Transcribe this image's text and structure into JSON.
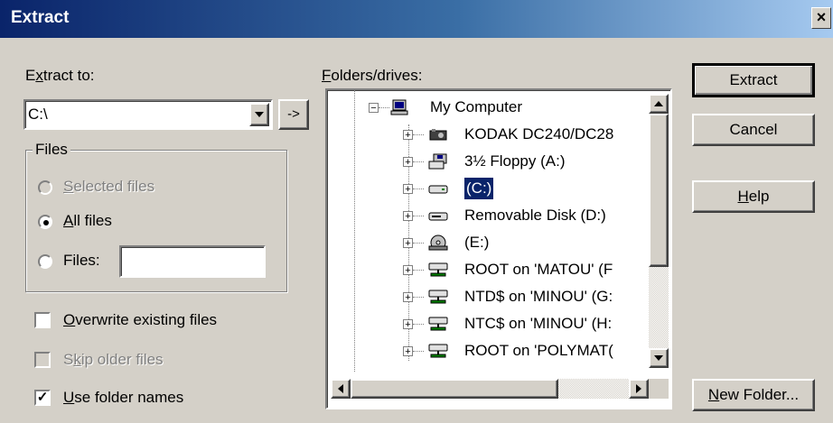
{
  "window": {
    "title": "Extract",
    "close_glyph": "×"
  },
  "extract_to": {
    "label_pre": "E",
    "label_ul": "x",
    "label_post": "tract to:",
    "value": "C:\\",
    "go_label": "->"
  },
  "files_group": {
    "legend": "Files",
    "selected": {
      "ul": "S",
      "rest": "elected files",
      "enabled": false
    },
    "all": {
      "ul": "A",
      "rest": "ll files",
      "checked": true
    },
    "files": {
      "ul": "",
      "rest": "Files:",
      "value": ""
    }
  },
  "options": {
    "overwrite": {
      "ul": "O",
      "rest": "verwrite existing files",
      "checked": false
    },
    "skip_older": {
      "pre": "S",
      "ul": "k",
      "rest": "ip older files",
      "checked": false,
      "enabled": false
    },
    "use_folder": {
      "ul": "U",
      "rest": "se folder names",
      "checked": true
    }
  },
  "folders": {
    "label_ul": "F",
    "label_rest": "olders/drives:",
    "items": [
      {
        "label": "My Computer",
        "icon": "computer-icon",
        "expander": "−"
      },
      {
        "label": "KODAK DC240/DC28",
        "icon": "camera-icon",
        "expander": "+"
      },
      {
        "label": "3½ Floppy (A:)",
        "icon": "floppy-icon",
        "expander": "+"
      },
      {
        "label": "(C:)",
        "icon": "hard-drive-icon",
        "expander": "+",
        "selected": true
      },
      {
        "label": "Removable Disk (D:)",
        "icon": "removable-disk-icon",
        "expander": "+"
      },
      {
        "label": " (E:)",
        "icon": "cd-drive-icon",
        "expander": "+"
      },
      {
        "label": "ROOT on 'MATOU' (F",
        "icon": "network-drive-icon",
        "expander": "+"
      },
      {
        "label": "NTD$ on 'MINOU' (G:",
        "icon": "network-drive-icon",
        "expander": "+"
      },
      {
        "label": "NTC$ on 'MINOU' (H:",
        "icon": "network-drive-icon",
        "expander": "+"
      },
      {
        "label": "ROOT on 'POLYMAT(",
        "icon": "network-drive-icon",
        "expander": "+"
      }
    ]
  },
  "buttons": {
    "extract": "Extract",
    "cancel": "Cancel",
    "help_ul": "H",
    "help_rest": "elp",
    "new_folder_ul": "N",
    "new_folder_rest": "ew Folder..."
  },
  "colors": {
    "title_start": "#0a246a",
    "title_end": "#a6caf0",
    "face": "#d4d0c8",
    "selection": "#0a246a"
  }
}
